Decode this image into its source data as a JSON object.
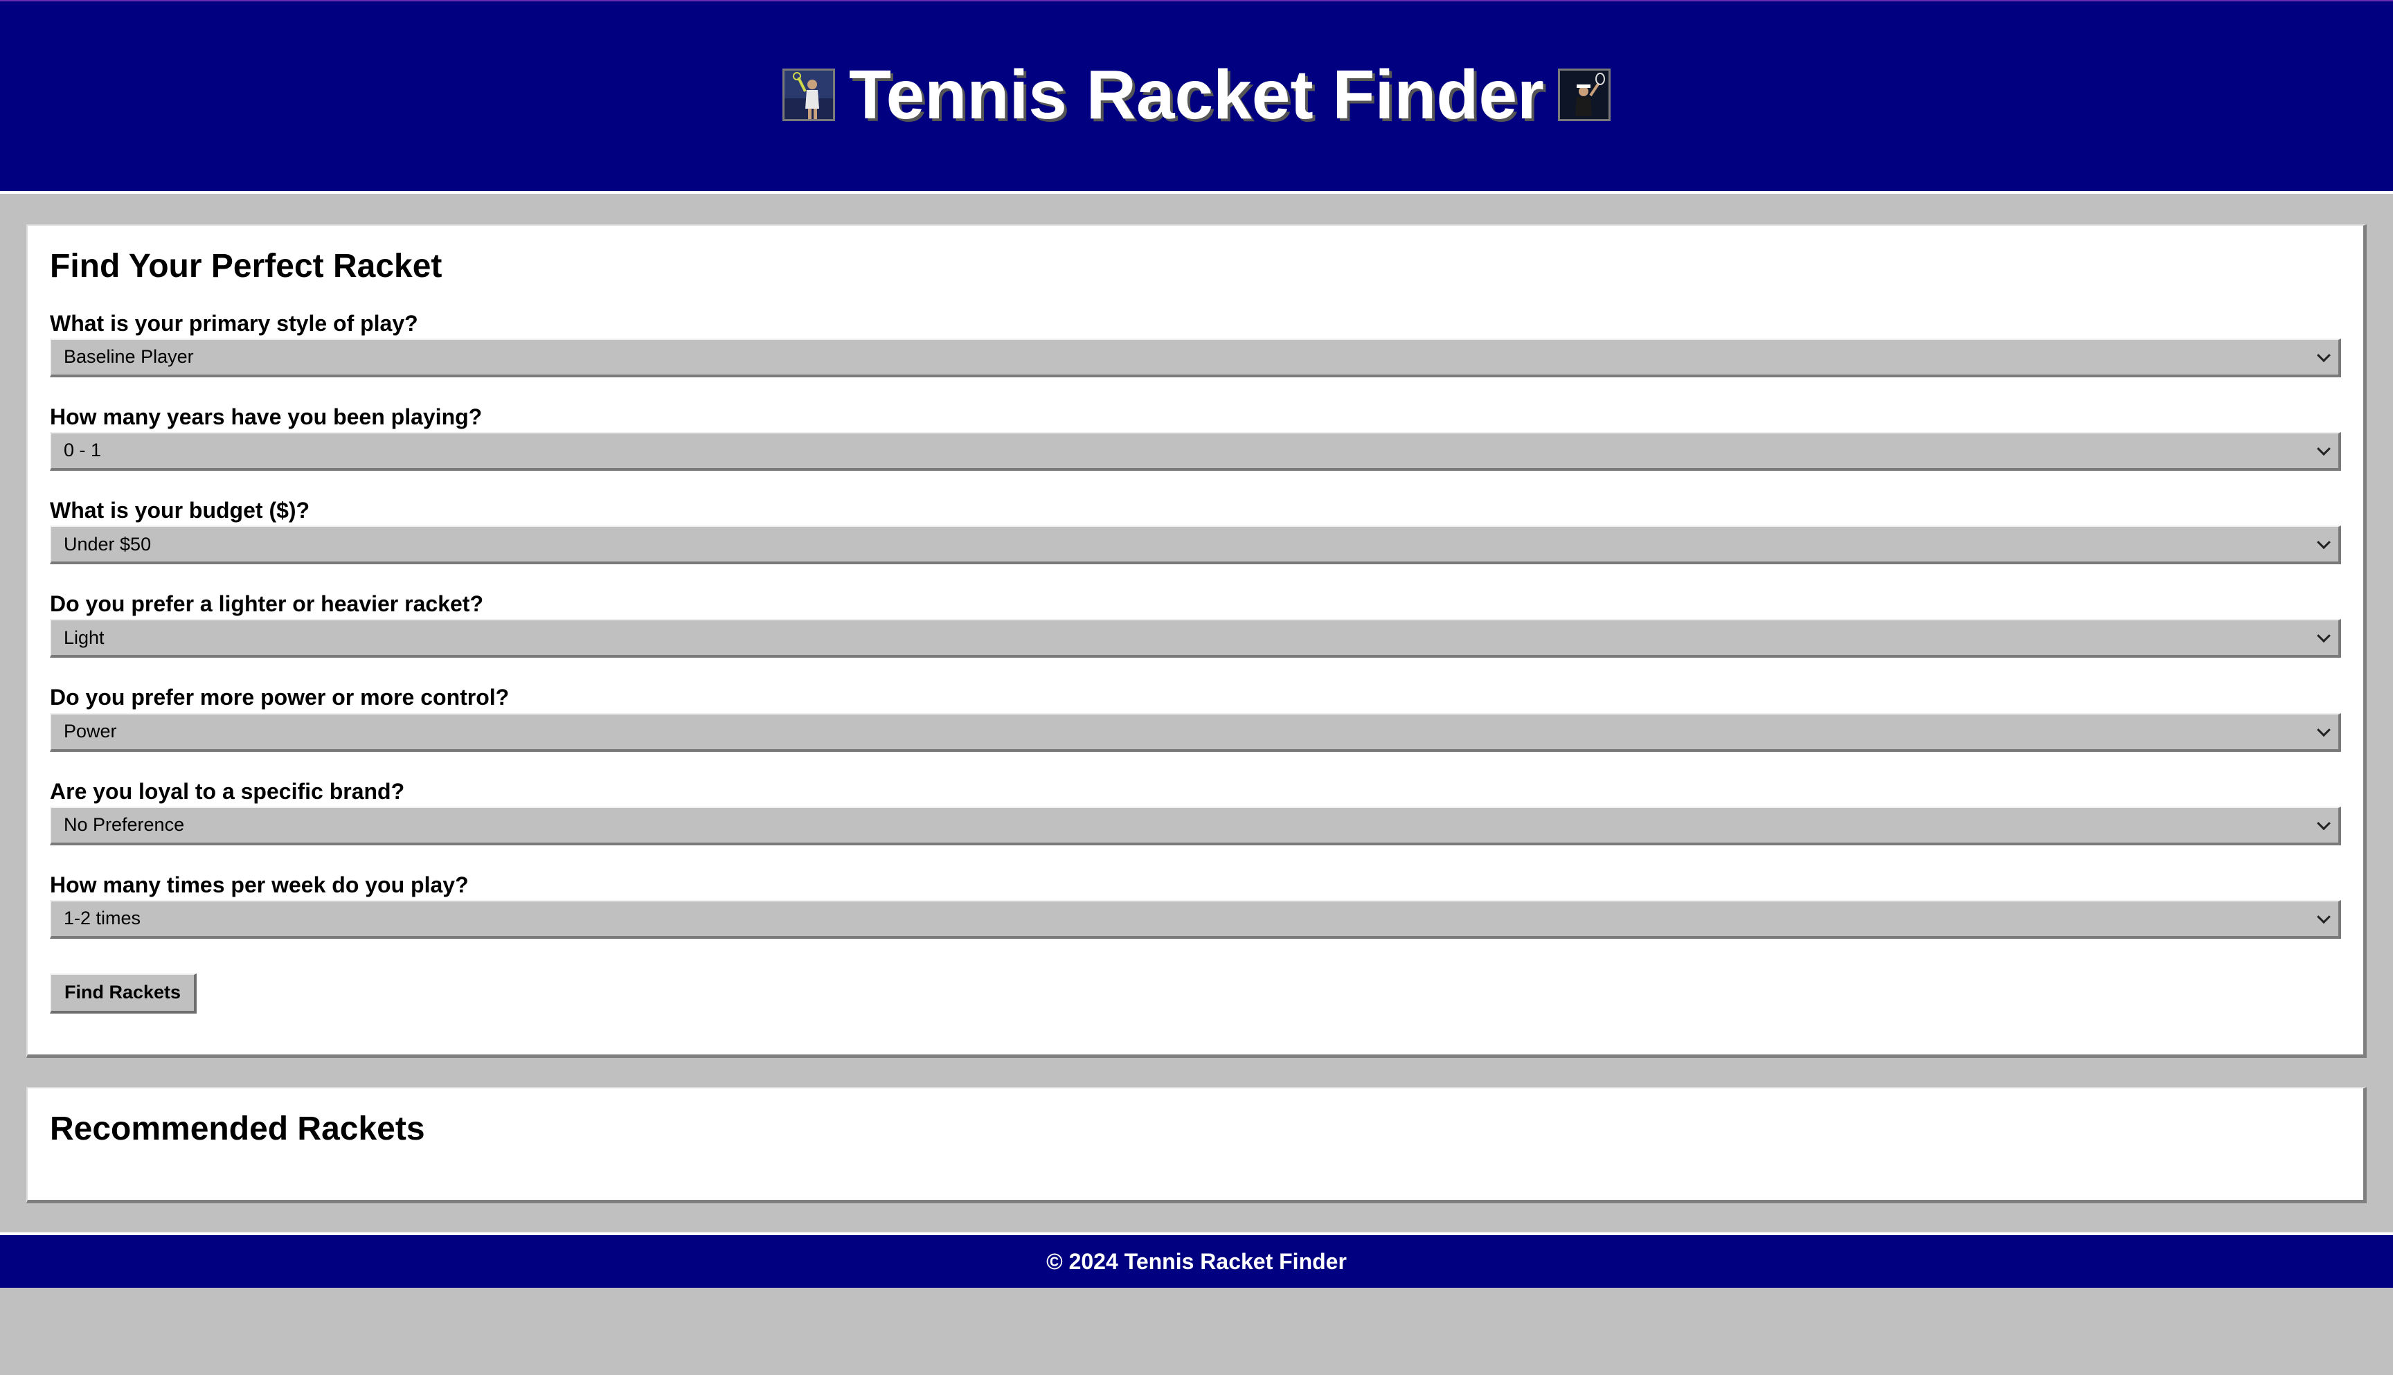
{
  "header": {
    "title": "Tennis Racket Finder",
    "left_image": "tennis-player-photo",
    "right_image": "tennis-player-photo"
  },
  "form": {
    "heading": "Find Your Perfect Racket",
    "questions": [
      {
        "label": "What is your primary style of play?",
        "value": "Baseline Player"
      },
      {
        "label": "How many years have you been playing?",
        "value": "0 - 1"
      },
      {
        "label": "What is your budget ($)?",
        "value": "Under $50"
      },
      {
        "label": "Do you prefer a lighter or heavier racket?",
        "value": "Light"
      },
      {
        "label": "Do you prefer more power or more control?",
        "value": "Power"
      },
      {
        "label": "Are you loyal to a specific brand?",
        "value": "No Preference"
      },
      {
        "label": "How many times per week do you play?",
        "value": "1-2 times"
      }
    ],
    "submit_label": "Find Rackets"
  },
  "results": {
    "heading": "Recommended Rackets"
  },
  "footer": {
    "text": "© 2024 Tennis Racket Finder"
  },
  "colors": {
    "header_bg": "#000080",
    "page_bg": "#c0c0c0",
    "panel_bg": "#ffffff",
    "control_bg": "#c0c0c0"
  }
}
